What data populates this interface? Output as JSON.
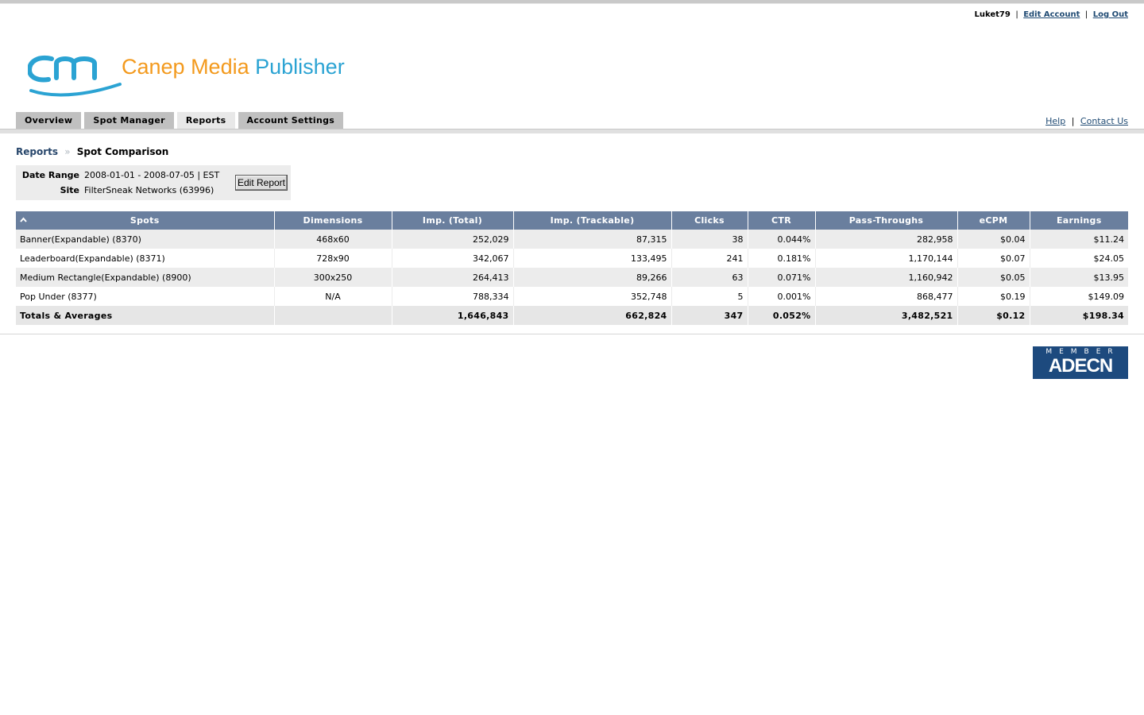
{
  "user": {
    "username": "Luket79",
    "edit_account": "Edit Account",
    "logout": "Log Out"
  },
  "brand": {
    "word1": "Canep Media",
    "word2": "Publisher",
    "colors": {
      "orange": "#f39a1e",
      "blue": "#2ba3d3"
    }
  },
  "nav": {
    "tabs": [
      "Overview",
      "Spot Manager",
      "Reports",
      "Account Settings"
    ],
    "active": "Reports"
  },
  "help_links": {
    "help": "Help",
    "contact": "Contact Us"
  },
  "breadcrumb": {
    "parent": "Reports",
    "current": "Spot Comparison"
  },
  "report": {
    "date_range_label": "Date Range",
    "date_range_value": "2008-01-01 - 2008-07-05 | EST",
    "site_label": "Site",
    "site_value": "FilterSneak Networks (63996)",
    "edit_button": "Edit Report"
  },
  "table": {
    "headers": [
      "Spots",
      "Dimensions",
      "Imp. (Total)",
      "Imp. (Trackable)",
      "Clicks",
      "CTR",
      "Pass-Throughs",
      "eCPM",
      "Earnings"
    ],
    "rows": [
      [
        "Banner(Expandable) (8370)",
        "468x60",
        "252,029",
        "87,315",
        "38",
        "0.044%",
        "282,958",
        "$0.04",
        "$11.24"
      ],
      [
        "Leaderboard(Expandable) (8371)",
        "728x90",
        "342,067",
        "133,495",
        "241",
        "0.181%",
        "1,170,144",
        "$0.07",
        "$24.05"
      ],
      [
        "Medium Rectangle(Expandable) (8900)",
        "300x250",
        "264,413",
        "89,266",
        "63",
        "0.071%",
        "1,160,942",
        "$0.05",
        "$13.95"
      ],
      [
        "Pop Under (8377)",
        "N/A",
        "788,334",
        "352,748",
        "5",
        "0.001%",
        "868,477",
        "$0.19",
        "$149.09"
      ]
    ],
    "totals": [
      "Totals & Averages",
      "",
      "1,646,843",
      "662,824",
      "347",
      "0.052%",
      "3,482,521",
      "$0.12",
      "$198.34"
    ],
    "header_color": "#6a7f9e"
  },
  "badge": {
    "member": "MEMBER",
    "name": "ADECN",
    "color": "#1d4a7e"
  }
}
